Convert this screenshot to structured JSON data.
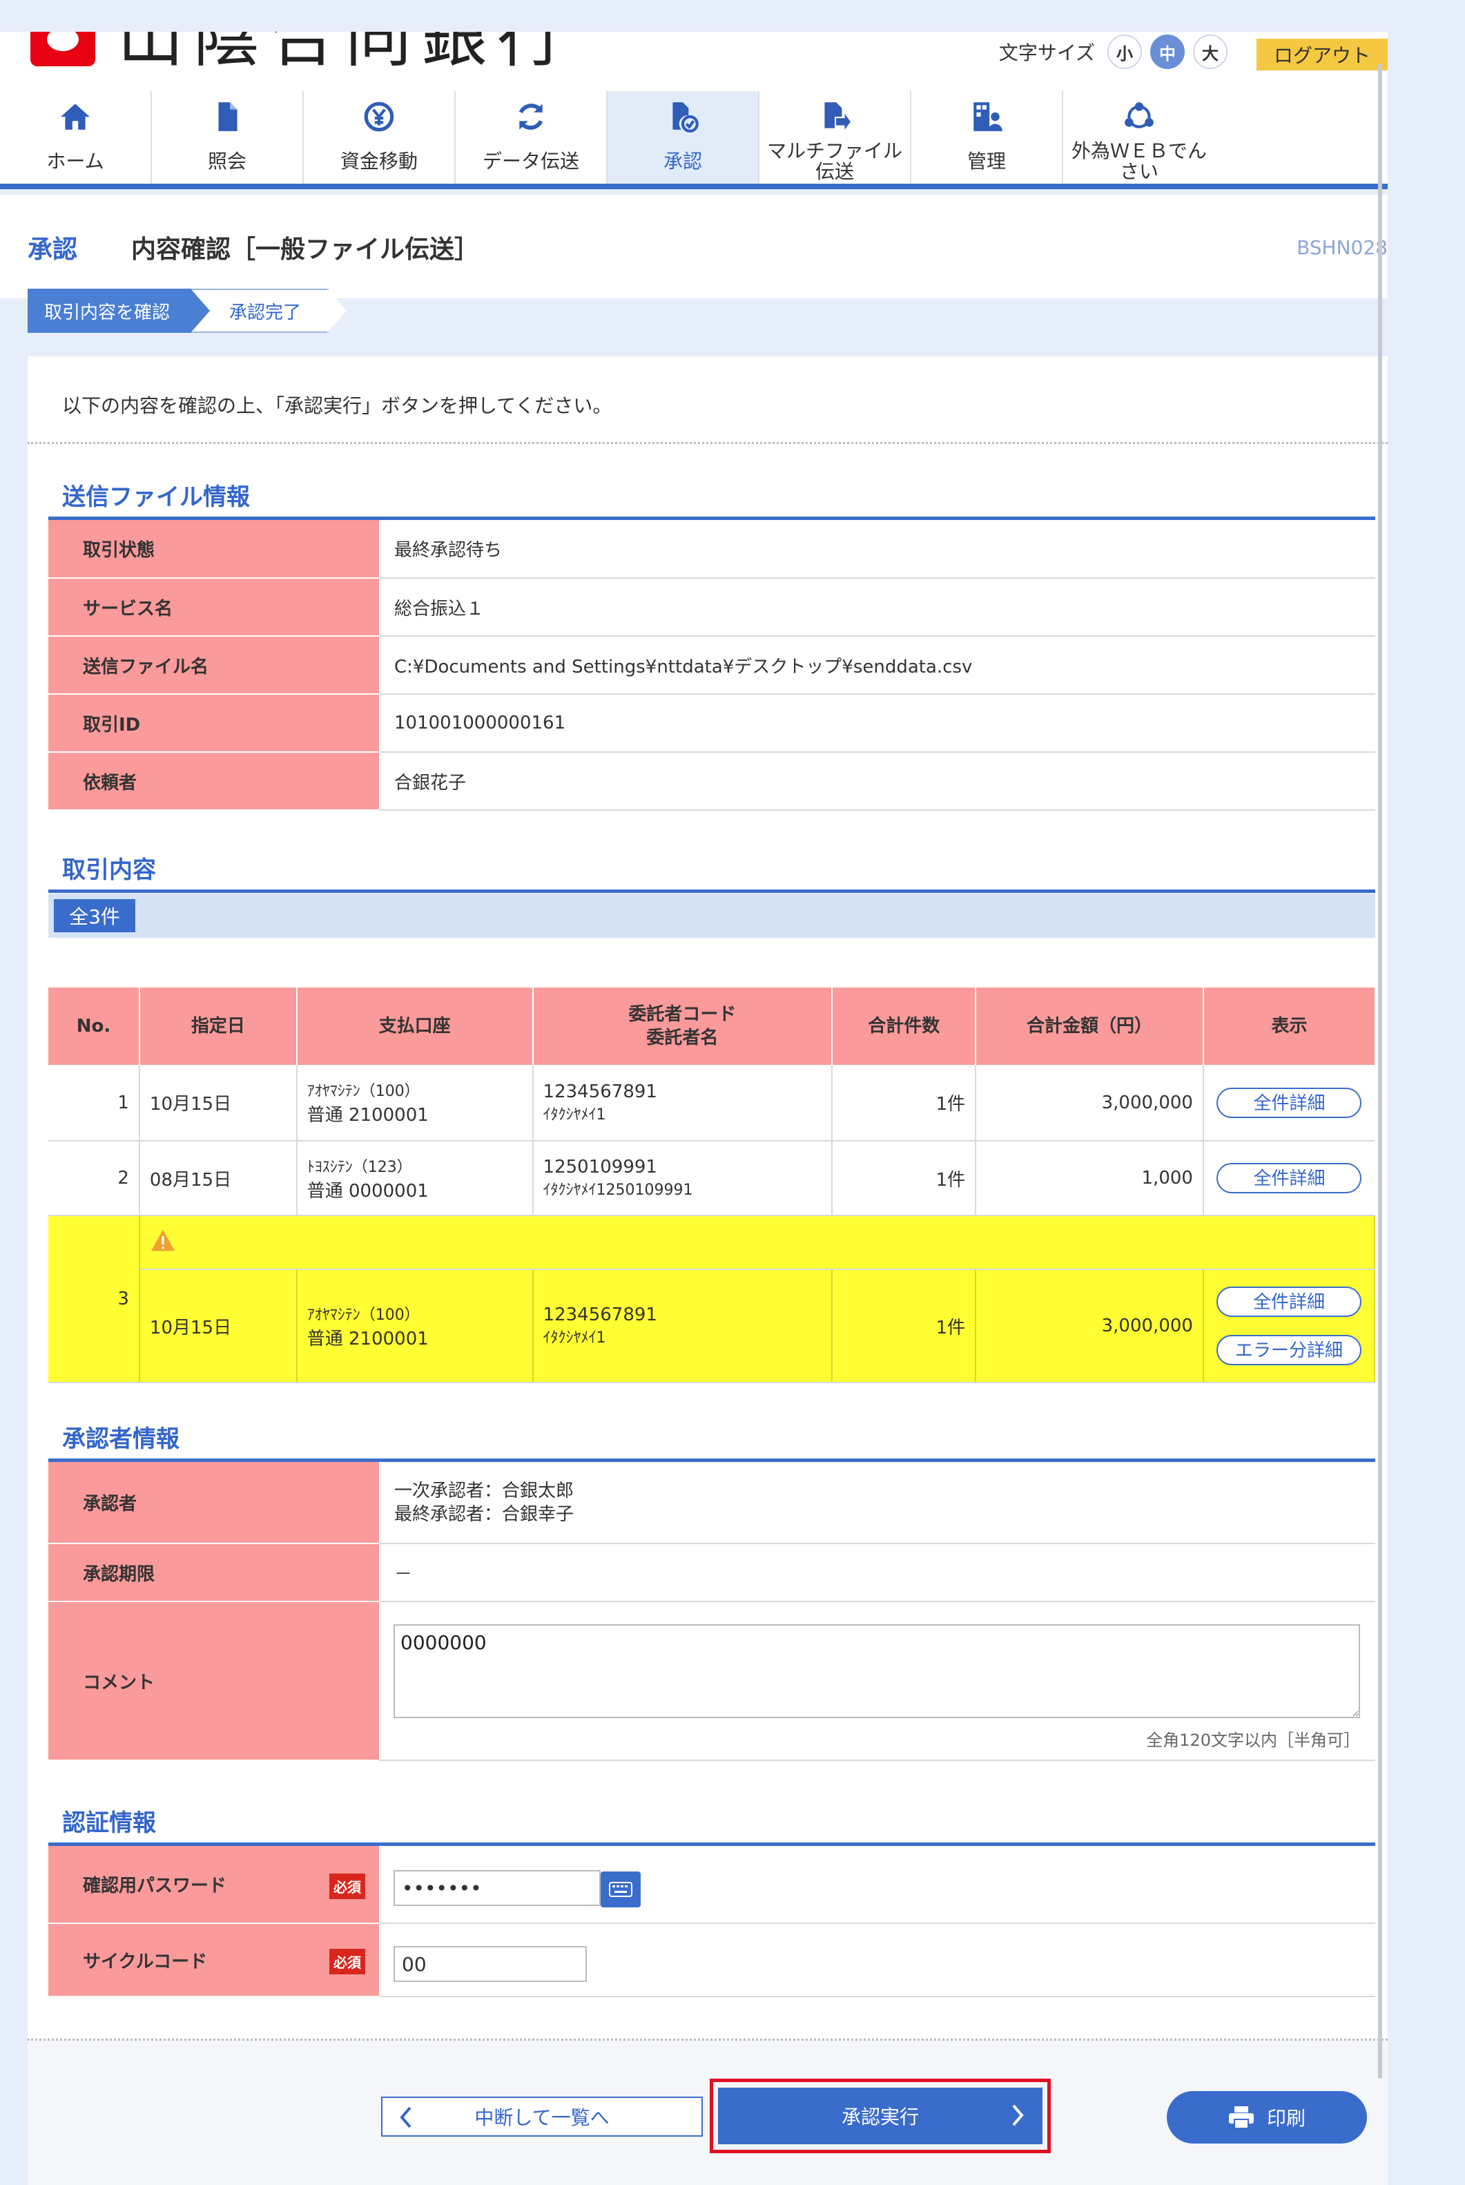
{
  "header": {
    "logo_text": "山陰合同銀行",
    "font_size_label": "文字サイズ",
    "font_sizes": [
      "小",
      "中",
      "大"
    ],
    "logout": "ログアウト"
  },
  "nav": [
    {
      "label": "ホーム",
      "icon": "home-icon"
    },
    {
      "label": "照会",
      "icon": "document-icon"
    },
    {
      "label": "資金移動",
      "icon": "yen-transfer-icon"
    },
    {
      "label": "データ伝送",
      "icon": "refresh-icon"
    },
    {
      "label": "承認",
      "icon": "approve-document-icon"
    },
    {
      "label": "マルチファイル伝送",
      "icon": "file-send-icon"
    },
    {
      "label": "管理",
      "icon": "building-user-icon"
    },
    {
      "label": "外為ＷＥＢでんさい",
      "icon": "network-icon"
    }
  ],
  "title": {
    "section": "承認",
    "page": "内容確認［一般ファイル伝送］",
    "code": "BSHN028"
  },
  "steps": [
    "取引内容を確認",
    "承認完了"
  ],
  "intro": "以下の内容を確認の上、「承認実行」ボタンを押してください。",
  "file_info": {
    "title": "送信ファイル情報",
    "rows": [
      {
        "label": "取引状態",
        "value": "最終承認待ち"
      },
      {
        "label": "サービス名",
        "value": "総合振込１"
      },
      {
        "label": "送信ファイル名",
        "value": "C:¥Documents and Settings¥nttdata¥デスクトップ¥senddata.csv"
      },
      {
        "label": "取引ID",
        "value": "101001000000161"
      },
      {
        "label": "依頼者",
        "value": "合銀花子"
      }
    ]
  },
  "transactions": {
    "title": "取引内容",
    "count": "全3件",
    "headers": [
      "No.",
      "指定日",
      "支払口座",
      "委託者コード",
      "委託者名",
      "合計件数",
      "合計金額（円）",
      "表示"
    ],
    "rows": [
      {
        "no": "1",
        "date": "10月15日",
        "bank": "ｱｵﾔﾏｼﾃﾝ（100）",
        "account": "普通 2100001",
        "code": "1234567891",
        "name": "ｲﾀｸｼﾔﾒｲ1",
        "count": "1件",
        "amount": "3,000,000",
        "btn": "全件詳細"
      },
      {
        "no": "2",
        "date": "08月15日",
        "bank": "ﾄﾖｽｼﾃﾝ（123）",
        "account": "普通 0000001",
        "code": "1250109991",
        "name": "ｲﾀｸｼﾔﾒｲ1250109991",
        "count": "1件",
        "amount": "1,000",
        "btn": "全件詳細"
      },
      {
        "no": "3",
        "date": "10月15日",
        "bank": "ｱｵﾔﾏｼﾃﾝ（100）",
        "account": "普通 2100001",
        "code": "1234567891",
        "name": "ｲﾀｸｼﾔﾒｲ1",
        "count": "1件",
        "amount": "3,000,000",
        "btn": "全件詳細",
        "btn2": "エラー分詳細"
      }
    ]
  },
  "approver": {
    "title": "承認者情報",
    "approver_label": "承認者",
    "approver_line1": "一次承認者：合銀太郎",
    "approver_line2": "最終承認者：合銀幸子",
    "deadline_label": "承認期限",
    "deadline_value": "－",
    "comment_label": "コメント",
    "comment_value": "0000000",
    "comment_hint": "全角120文字以内［半角可］"
  },
  "auth": {
    "title": "認証情報",
    "password_label": "確認用パスワード",
    "password_value": "•••••••",
    "cycle_label": "サイクルコード",
    "cycle_value": "00",
    "required": "必須"
  },
  "buttons": {
    "back": "中断して一覧へ",
    "execute": "承認実行",
    "print": "印刷"
  },
  "colors": {
    "accent": "#3a6ccc",
    "header_cell": "#fa9a9a",
    "warning_row": "#ffff33",
    "highlight": "#e01020"
  }
}
